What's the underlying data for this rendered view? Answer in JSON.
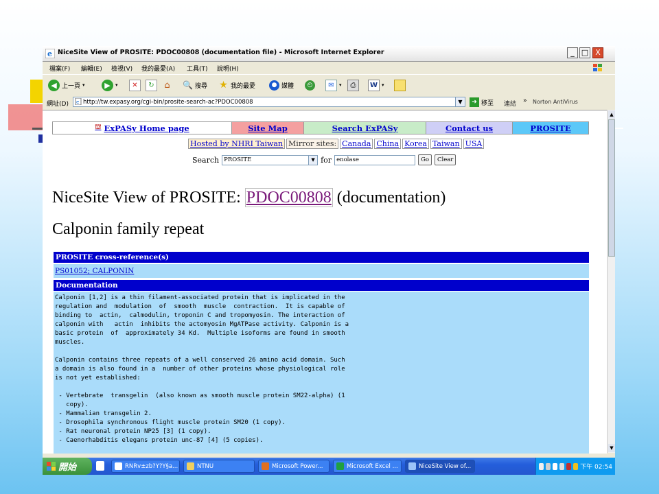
{
  "window": {
    "title": "NiceSite View of PROSITE: PDOC00808 (documentation file) - Microsoft Internet Explorer",
    "controls": {
      "minimize": "_",
      "maximize": "□",
      "close": "X"
    }
  },
  "menubar": [
    "檔案(F)",
    "編輯(E)",
    "檢視(V)",
    "我的最愛(A)",
    "工具(T)",
    "說明(H)"
  ],
  "toolbar": {
    "back": "上一頁",
    "search": "搜尋",
    "favorites": "我的最愛",
    "media": "媒體"
  },
  "addressbar": {
    "label": "網址(D)",
    "url": "http://tw.expasy.org/cgi-bin/prosite-search-ac?PDOC00808",
    "go": "移至",
    "links": "連結",
    "norton": "Norton AntiVirus"
  },
  "nav": [
    {
      "label": "ExPASy Home page",
      "color": "#ffffff"
    },
    {
      "label": "Site Map",
      "color": "#f4a0a0"
    },
    {
      "label": "Search ExPASy",
      "color": "#c8ecc8"
    },
    {
      "label": "Contact us",
      "color": "#cfcff6"
    },
    {
      "label": "PROSITE",
      "color": "#5cc8f8"
    }
  ],
  "mirrors": {
    "hosted": "Hosted by NHRI Taiwan",
    "label": "Mirror sites:",
    "sites": [
      "Canada",
      "China",
      "Korea",
      "Taiwan",
      "USA"
    ]
  },
  "search": {
    "label": "Search",
    "db": "PROSITE",
    "for": "for",
    "query": "enolase",
    "go": "Go",
    "clear": "Clear"
  },
  "heading": {
    "prefix": "NiceSite View of PROSITE:",
    "accession": "PDOC00808",
    "suffix": "(documentation)"
  },
  "subtitle": "Calponin family repeat",
  "xref": {
    "header": "PROSITE cross-reference(s)",
    "link": "PS01052; CALPONIN"
  },
  "documentation": {
    "header": "Documentation",
    "text": "Calponin [1,2] is a thin filament-associated protein that is implicated in the\nregulation and  modulation  of  smooth  muscle  contraction.  It is capable of\nbinding to  actin,  calmodulin, troponin C and tropomyosin. The interaction of\ncalponin with   actin  inhibits the actomyosin MgATPase activity. Calponin is a\nbasic protein  of  approximately 34 Kd.  Multiple isoforms are found in smooth\nmuscles.\n\nCalponin contains three repeats of a well conserved 26 amino acid domain. Such\na domain is also found in a  number of other proteins whose physiological role\nis not yet established:\n\n - Vertebrate  transgelin  (also known as smooth muscle protein SM22-alpha) (1\n   copy).\n - Mammalian transgelin 2.\n - Drosophila synchronous flight muscle protein SM20 (1 copy).\n - Rat neuronal protein NP25 [3] (1 copy).\n - Caenorhabditis elegans protein unc-87 [4] (5 copies)."
  },
  "taskbar": {
    "start": "開始",
    "tasks": [
      "RNRv±zb?Y?Y§a...",
      "NTNU",
      "Microsoft Power...",
      "Microsoft Excel ...",
      "NiceSite View of..."
    ],
    "clock": "下午 02:54"
  }
}
